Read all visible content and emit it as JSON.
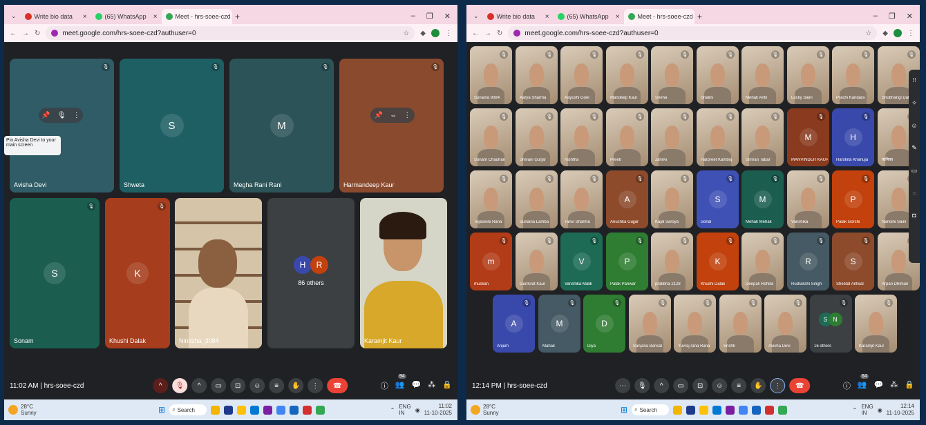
{
  "left": {
    "tabs": [
      {
        "label": "Write bio data",
        "color": "#d93025"
      },
      {
        "label": "(65) WhatsApp",
        "color": "#25d366"
      },
      {
        "label": "Meet - hrs-soee-czd",
        "color": "#34a853"
      }
    ],
    "url": "meet.google.com/hrs-soee-czd?authuser=0",
    "tooltip": "Pin Avisha Devi to your main screen",
    "top_tiles": [
      {
        "name": "Avisha Devi",
        "initial": "",
        "bg": "#2f5c66",
        "avatar": ""
      },
      {
        "name": "Shweta",
        "initial": "S",
        "bg": "#1e5f63",
        "avatar": "#0e7c86"
      },
      {
        "name": "Megha Rani Rani",
        "initial": "M",
        "bg": "#2c5458",
        "avatar": "#455a64"
      },
      {
        "name": "Harmandeep Kaur",
        "initial": "",
        "bg": "#8a4a2e",
        "avatar": ""
      }
    ],
    "bottom_tiles": [
      {
        "name": "Sonam",
        "initial": "S",
        "bg": "#1b5e50",
        "avatar": "#16806b"
      },
      {
        "name": "Khushi Dalak",
        "initial": "K",
        "bg": "#a63d1d",
        "avatar": "#c2410c"
      }
    ],
    "video_tiles": [
      {
        "name": "Nimisha_3084"
      },
      {
        "name": "Karamjit Kaur"
      }
    ],
    "others": {
      "label": "86 others",
      "a": "H",
      "b": "R"
    },
    "time": "11:02 AM",
    "meeting_code": "hrs-soee-czd",
    "people_count": "94",
    "weather_temp": "28°C",
    "weather_desc": "Sunny",
    "search_label": "Search",
    "lang": "ENG",
    "lang2": "IN",
    "clock_time": "11:02",
    "clock_date": "11-10-2025"
  },
  "right": {
    "tabs": [
      {
        "label": "Write bio data",
        "color": "#d93025"
      },
      {
        "label": "(65) WhatsApp",
        "color": "#25d366"
      },
      {
        "label": "Meet - hrs-soee-czd",
        "color": "#34a853"
      }
    ],
    "url": "meet.google.com/hrs-soee-czd?authuser=0",
    "rows": [
      [
        {
          "name": "Sunaina 9084",
          "type": "photo"
        },
        {
          "name": "Aarya Sharma",
          "type": "photo"
        },
        {
          "name": "Aayushi Goel",
          "type": "photo"
        },
        {
          "name": "Mandeep Kaur",
          "type": "photo"
        },
        {
          "name": "Sneha",
          "type": "photo"
        },
        {
          "name": "Shalini",
          "type": "photo"
        },
        {
          "name": "Mehak Antil",
          "type": "photo"
        },
        {
          "name": "Lucky Saini",
          "type": "photo"
        },
        {
          "name": "Prachi Kandara",
          "type": "photo"
        },
        {
          "name": "Shubhangi Dahiya",
          "type": "photo"
        }
      ],
      [
        {
          "name": "Sonam Chauhan",
          "type": "photo"
        },
        {
          "name": "Shivani Gurjar",
          "type": "photo"
        },
        {
          "name": "Nishtha",
          "type": "photo"
        },
        {
          "name": "Preeti",
          "type": "photo"
        },
        {
          "name": "Jahnvi",
          "type": "photo"
        },
        {
          "name": "Harpreet Kamboj",
          "type": "photo"
        },
        {
          "name": "Simran Tabar",
          "type": "photo"
        },
        {
          "name": "MANVINDER KAUR",
          "type": "avatar",
          "initial": "M",
          "bg": "#8a3a1e"
        },
        {
          "name": "Harshita Khanuja",
          "type": "avatar",
          "initial": "H",
          "bg": "#3949ab"
        },
        {
          "name": "ऋषिका",
          "type": "photo"
        }
      ],
      [
        {
          "name": "Tejaswini Rana",
          "type": "photo"
        },
        {
          "name": "Sunaina Lamba",
          "type": "photo"
        },
        {
          "name": "Tanvi Sharma",
          "type": "photo"
        },
        {
          "name": "Anushka Gujjar",
          "type": "avatar",
          "initial": "A",
          "bg": "#8d4b2c"
        },
        {
          "name": "Kajal Saroya",
          "type": "photo"
        },
        {
          "name": "Sonal",
          "type": "avatar",
          "initial": "S",
          "bg": "#3f51b5"
        },
        {
          "name": "Mehak Mehak",
          "type": "avatar",
          "initial": "M",
          "bg": "#1b5e50"
        },
        {
          "name": "Vanshika",
          "type": "photo"
        },
        {
          "name": "Palak Gorshi",
          "type": "avatar",
          "initial": "P",
          "bg": "#c2410c"
        },
        {
          "name": "Nandini Saini",
          "type": "photo"
        }
      ],
      [
        {
          "name": "muskan",
          "type": "avatar",
          "initial": "m",
          "bg": "#b23c17"
        },
        {
          "name": "Gunkirat Kaur",
          "type": "photo"
        },
        {
          "name": "Vanshika Malik",
          "type": "avatar",
          "initial": "V",
          "bg": "#1d6b55"
        },
        {
          "name": "Palak Panwar",
          "type": "avatar",
          "initial": "P",
          "bg": "#2e7d32"
        },
        {
          "name": "pratibha 2128",
          "type": "photo"
        },
        {
          "name": "Khushi Dalak",
          "type": "avatar",
          "initial": "K",
          "bg": "#c2410c"
        },
        {
          "name": "Deepali Rohilla",
          "type": "photo"
        },
        {
          "name": "Rudrakshi Singh",
          "type": "avatar",
          "initial": "R",
          "bg": "#455a64"
        },
        {
          "name": "Sheetal Antwal",
          "type": "avatar",
          "initial": "S",
          "bg": "#8d4b2c"
        },
        {
          "name": "Arpan Dhiman",
          "type": "photo"
        }
      ],
      [
        {
          "name": "Anjum",
          "type": "avatar",
          "initial": "A",
          "bg": "#3949ab"
        },
        {
          "name": "Mahak",
          "type": "avatar",
          "initial": "M",
          "bg": "#455a64"
        },
        {
          "name": "Diya",
          "type": "avatar",
          "initial": "D",
          "bg": "#2e7d32"
        },
        {
          "name": "Sanjana Bansal",
          "type": "photo"
        },
        {
          "name": "Yuvraj rana Rana",
          "type": "photo"
        },
        {
          "name": "Srishti",
          "type": "photo"
        },
        {
          "name": "Avisha Devi",
          "type": "photo"
        },
        {
          "name": "16 others",
          "type": "others",
          "a": "S",
          "b": "N"
        },
        {
          "name": "Karamjit Kaur",
          "type": "photo"
        }
      ]
    ],
    "time": "12:14 PM",
    "meeting_code": "hrs-soee-czd",
    "people_count": "64",
    "weather_temp": "28°C",
    "weather_desc": "Sunny",
    "search_label": "Search",
    "lang": "ENG",
    "lang2": "IN",
    "clock_time": "12:14",
    "clock_date": "11-10-2025"
  }
}
